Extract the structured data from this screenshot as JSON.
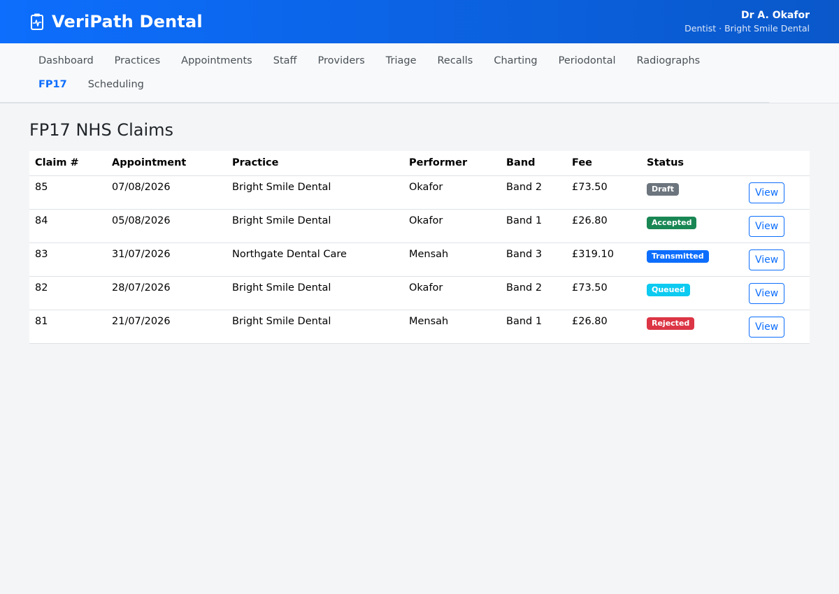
{
  "header": {
    "brand_name": "VeriPath Dental",
    "brand_icon": "clipboard-pulse-icon",
    "user_name": "Dr A. Okafor",
    "user_role": "Dentist · Bright Smile Dental"
  },
  "nav": {
    "items": [
      {
        "label": "Dashboard",
        "active": false
      },
      {
        "label": "Practices",
        "active": false
      },
      {
        "label": "Appointments",
        "active": false
      },
      {
        "label": "Staff",
        "active": false
      },
      {
        "label": "Providers",
        "active": false
      },
      {
        "label": "Triage",
        "active": false
      },
      {
        "label": "Recalls",
        "active": false
      },
      {
        "label": "Charting",
        "active": false
      },
      {
        "label": "Periodontal",
        "active": false
      },
      {
        "label": "Radiographs",
        "active": false
      },
      {
        "label": "FP17",
        "active": true
      },
      {
        "label": "Scheduling",
        "active": false
      }
    ]
  },
  "main": {
    "title": "FP17 NHS Claims",
    "table": {
      "headers": [
        "Claim #",
        "Appointment",
        "Practice",
        "Performer",
        "Band",
        "Fee",
        "Status",
        ""
      ],
      "rows": [
        {
          "claim": "85",
          "appointment": "07/08/2026",
          "practice": "Bright Smile Dental",
          "performer": "Okafor",
          "band": "Band 2",
          "fee": "£73.50",
          "status": "Draft",
          "status_color": "#6c757d",
          "action": "View"
        },
        {
          "claim": "84",
          "appointment": "05/08/2026",
          "practice": "Bright Smile Dental",
          "performer": "Okafor",
          "band": "Band 1",
          "fee": "£26.80",
          "status": "Accepted",
          "status_color": "#198754",
          "action": "View"
        },
        {
          "claim": "83",
          "appointment": "31/07/2026",
          "practice": "Northgate Dental Care",
          "performer": "Mensah",
          "band": "Band 3",
          "fee": "£319.10",
          "status": "Transmitted",
          "status_color": "#0d6efd",
          "action": "View"
        },
        {
          "claim": "82",
          "appointment": "28/07/2026",
          "practice": "Bright Smile Dental",
          "performer": "Okafor",
          "band": "Band 2",
          "fee": "£73.50",
          "status": "Queued",
          "status_color": "#0dcaf0",
          "action": "View"
        },
        {
          "claim": "81",
          "appointment": "21/07/2026",
          "practice": "Bright Smile Dental",
          "performer": "Mensah",
          "band": "Band 1",
          "fee": "£26.80",
          "status": "Rejected",
          "status_color": "#dc3545",
          "action": "View"
        }
      ]
    }
  },
  "colors": {
    "accent": "#0d6efd",
    "header_gradient_end": "#0a58ca",
    "background": "#f4f5f7"
  }
}
